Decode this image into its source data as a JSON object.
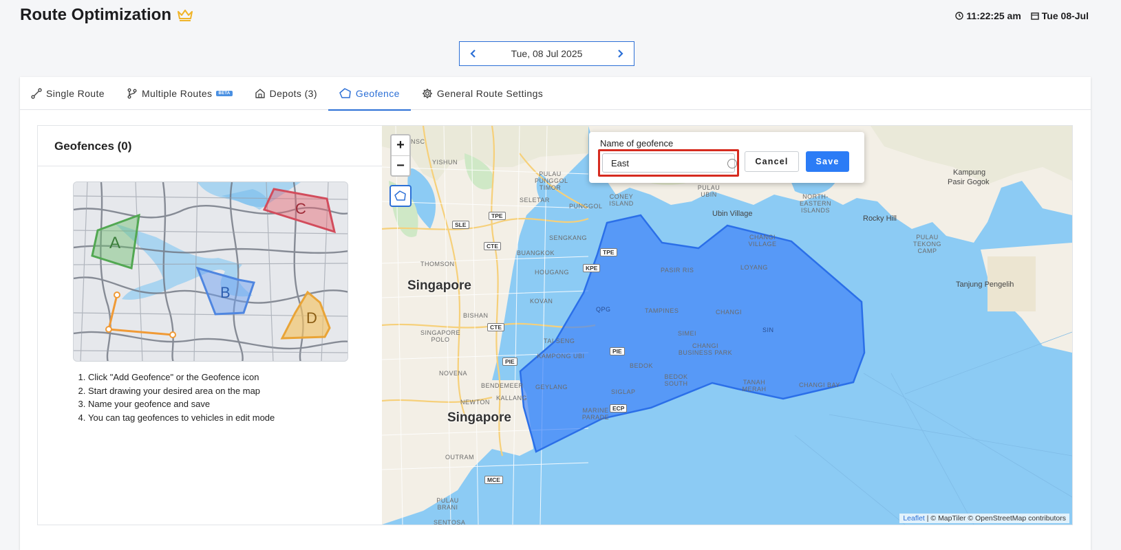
{
  "header": {
    "title": "Route Optimization",
    "time": "11:22:25 am",
    "date": "Tue 08-Jul"
  },
  "datepicker": {
    "value": "Tue, 08 Jul 2025"
  },
  "tabs": [
    {
      "label": "Single Route",
      "icon": "route-icon"
    },
    {
      "label": "Multiple Routes",
      "badge": "BETA",
      "icon": "branch-icon"
    },
    {
      "label": "Depots (3)",
      "icon": "home-icon"
    },
    {
      "label": "Geofence",
      "icon": "polygon-icon",
      "active": true
    },
    {
      "label": "General Route Settings",
      "icon": "gear-icon"
    }
  ],
  "geofences": {
    "title": "Geofences (0)",
    "illustration_labels": [
      "A",
      "B",
      "C",
      "D"
    ],
    "steps": [
      "Click \"Add Geofence\" or the Geofence icon",
      "Start drawing your desired area on the map",
      "Name your geofence and save",
      "You can tag geofences to vehicles in edit mode"
    ]
  },
  "map": {
    "zoom_in": "+",
    "zoom_out": "−",
    "attribution_leaflet": "Leaflet",
    "attribution_rest": "| © MapTiler © OpenStreetMap contributors",
    "labels": {
      "singapore_top": "Singapore",
      "singapore_bottom": "Singapore",
      "kampung": "Kampung",
      "pasir_gogok": "Pasir Gogok",
      "rocky_hill": "Rocky Hill",
      "ubin_village": "Ubin Village",
      "tanjung": "Tanjung Pengelih",
      "yishun": "YISHUN",
      "seletar": "SELETAR",
      "punggol": "PUNGGOL",
      "sengkang": "SENGKANG",
      "buangkok": "BUANGKOK",
      "thomson": "THOMSON",
      "hougang": "HOUGANG",
      "pasir_ris": "PASIR RIS",
      "loyang": "LOYANG",
      "tampines": "TAMPINES",
      "changi": "CHANGI",
      "kovan": "KOVAN",
      "bishan": "BISHAN",
      "simei": "SIMEI",
      "changi_bp": "CHANGI BUSINESS PARK",
      "tai_seng": "TAI SENG",
      "kampong_ubi": "KAMPONG UBI",
      "bedok": "BEDOK",
      "bedok_south": "BEDOK SOUTH",
      "tanah_merah": "TANAH MERAH",
      "changi_bay": "CHANGI BAY",
      "geylang": "GEYLANG",
      "siglap": "SIGLAP",
      "novena": "NOVENA",
      "bendemeer": "BENDEMEER",
      "kallang": "KALLANG",
      "newton": "NEWTON",
      "marine_parade": "MARINE PARADE",
      "outram": "OUTRAM",
      "sentosa": "SENTOSA",
      "ne_islands": "NORTH-EASTERN ISLANDS",
      "sin": "SIN",
      "qpg": "QPG",
      "coney": "CONEY ISLAND",
      "pulau_tekong": "PULAU TEKONG CAMP",
      "pulau_ubin": "PULAU UBIN",
      "nsc": "NSC",
      "pulau_punggol": "PULAU PUNGGOL TIMOR",
      "singapore_zoo": "SINGAPORE POLO",
      "changi_village": "CHANGI VILLAGE",
      "pulau_bukom": "PULAU BRANI"
    },
    "shields": [
      "TPE",
      "SLE",
      "CTE",
      "KPE",
      "TPE",
      "CTE",
      "PIE",
      "PIE",
      "ECP",
      "MCE"
    ]
  },
  "popup": {
    "label": "Name of geofence",
    "value": "East",
    "cancel": "Cancel",
    "save": "Save"
  }
}
